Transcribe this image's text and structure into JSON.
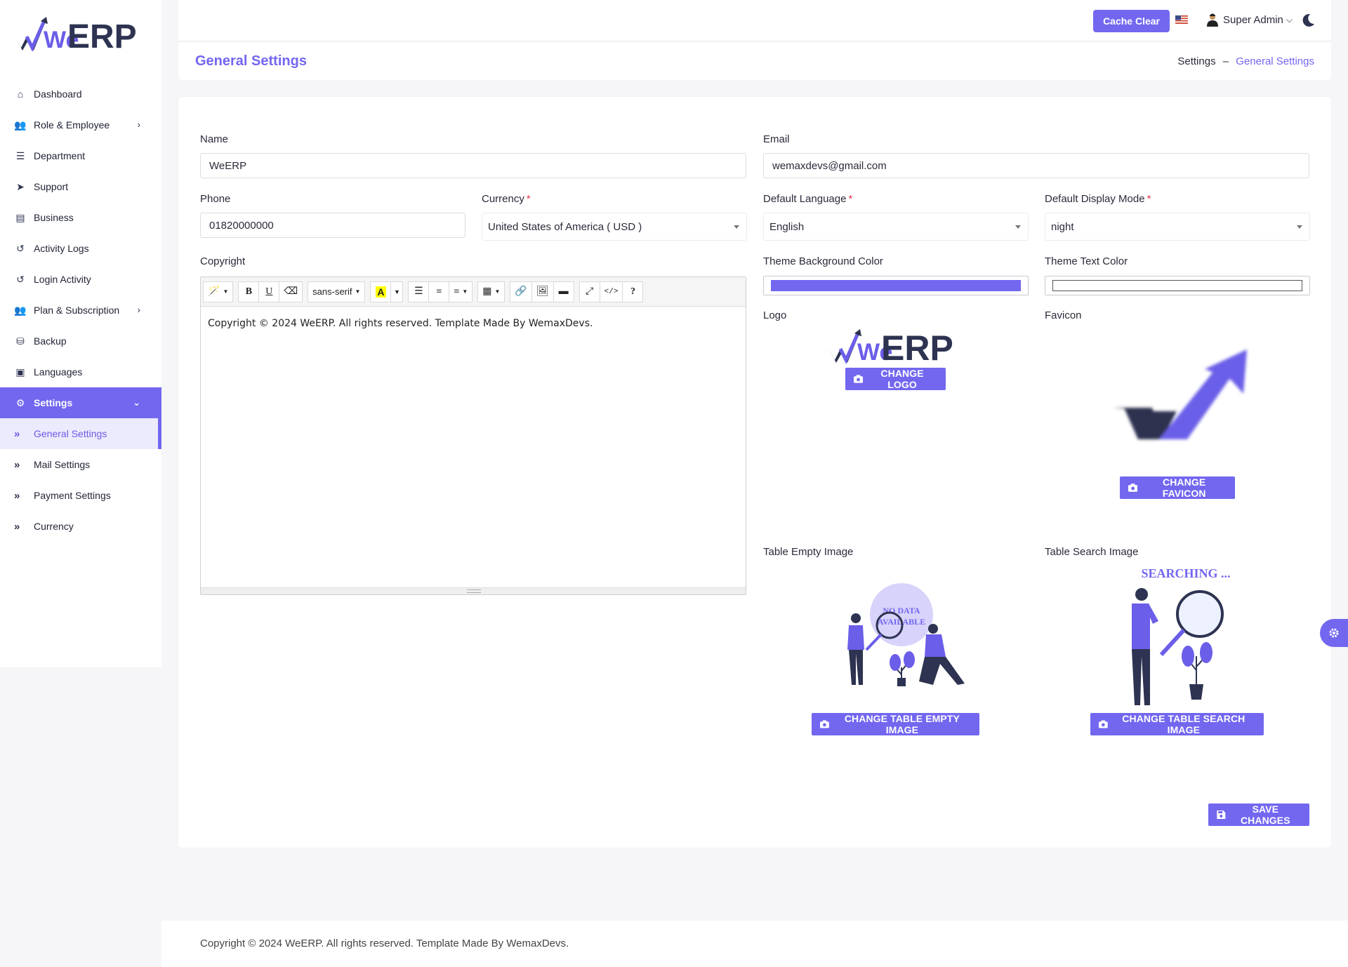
{
  "brand": {
    "logo_text_we": "We",
    "logo_text_erp": "ERP",
    "accent": "#7367f0"
  },
  "sidebar": {
    "items": [
      {
        "label": "Dashboard",
        "icon": "home-icon",
        "has_chevron": false
      },
      {
        "label": "Role & Employee",
        "icon": "users-icon",
        "has_chevron": true
      },
      {
        "label": "Department",
        "icon": "list-icon",
        "has_chevron": false
      },
      {
        "label": "Support",
        "icon": "paper-plane-icon",
        "has_chevron": false
      },
      {
        "label": "Business",
        "icon": "business-icon",
        "has_chevron": false
      },
      {
        "label": "Activity Logs",
        "icon": "history-icon",
        "has_chevron": false
      },
      {
        "label": "Login Activity",
        "icon": "history-icon",
        "has_chevron": false
      },
      {
        "label": "Plan & Subscription",
        "icon": "users-icon",
        "has_chevron": true
      },
      {
        "label": "Backup",
        "icon": "database-icon",
        "has_chevron": false
      },
      {
        "label": "Languages",
        "icon": "language-icon",
        "has_chevron": false
      },
      {
        "label": "Settings",
        "icon": "cogs-icon",
        "has_chevron": true,
        "active": true
      }
    ],
    "sub_items": [
      {
        "label": "General Settings",
        "current": true
      },
      {
        "label": "Mail Settings"
      },
      {
        "label": "Payment Settings"
      },
      {
        "label": "Currency"
      }
    ]
  },
  "topbar": {
    "cache_button": "Cache Clear",
    "flag": "us-flag-icon",
    "user_name": "Super Admin",
    "theme_toggle": "moon-icon"
  },
  "page": {
    "title": "General Settings",
    "breadcrumb": [
      "Settings",
      "General Settings"
    ],
    "breadcrumb_sep": "–"
  },
  "form": {
    "name": {
      "label": "Name",
      "value": "WeERP"
    },
    "email": {
      "label": "Email",
      "value": "wemaxdevs@gmail.com"
    },
    "phone": {
      "label": "Phone",
      "value": "01820000000"
    },
    "currency": {
      "label": "Currency",
      "required": "*",
      "value": "United States of America ( USD )"
    },
    "default_language": {
      "label": "Default Language",
      "required": "*",
      "value": "English"
    },
    "default_display_mode": {
      "label": "Default Display Mode",
      "required": "*",
      "value": "night"
    },
    "copyright": {
      "label": "Copyright",
      "value": "Copyright © 2024 WeERP. All rights reserved. Template Made By WemaxDevs."
    },
    "theme_bg_color": {
      "label": "Theme Background Color",
      "value": "#7367f0"
    },
    "theme_text_color": {
      "label": "Theme Text Color",
      "value": "#ffffff"
    },
    "logo": {
      "label": "Logo",
      "button": "CHANGE LOGO"
    },
    "favicon": {
      "label": "Favicon",
      "button": "CHANGE FAVICON"
    },
    "table_empty_image": {
      "label": "Table Empty Image",
      "button": "CHANGE TABLE EMPTY IMAGE",
      "art_text": [
        "NO DATA",
        "AVAILABLE"
      ]
    },
    "table_search_image": {
      "label": "Table Search Image",
      "button": "CHANGE TABLE SEARCH IMAGE",
      "art_text": "SEARCHING ..."
    },
    "save_button": "SAVE CHANGES"
  },
  "editor_toolbar": {
    "font": "sans-serif"
  },
  "footer": {
    "text": "Copyright © 2024 WeERP. All rights reserved. Template Made By WemaxDevs."
  }
}
